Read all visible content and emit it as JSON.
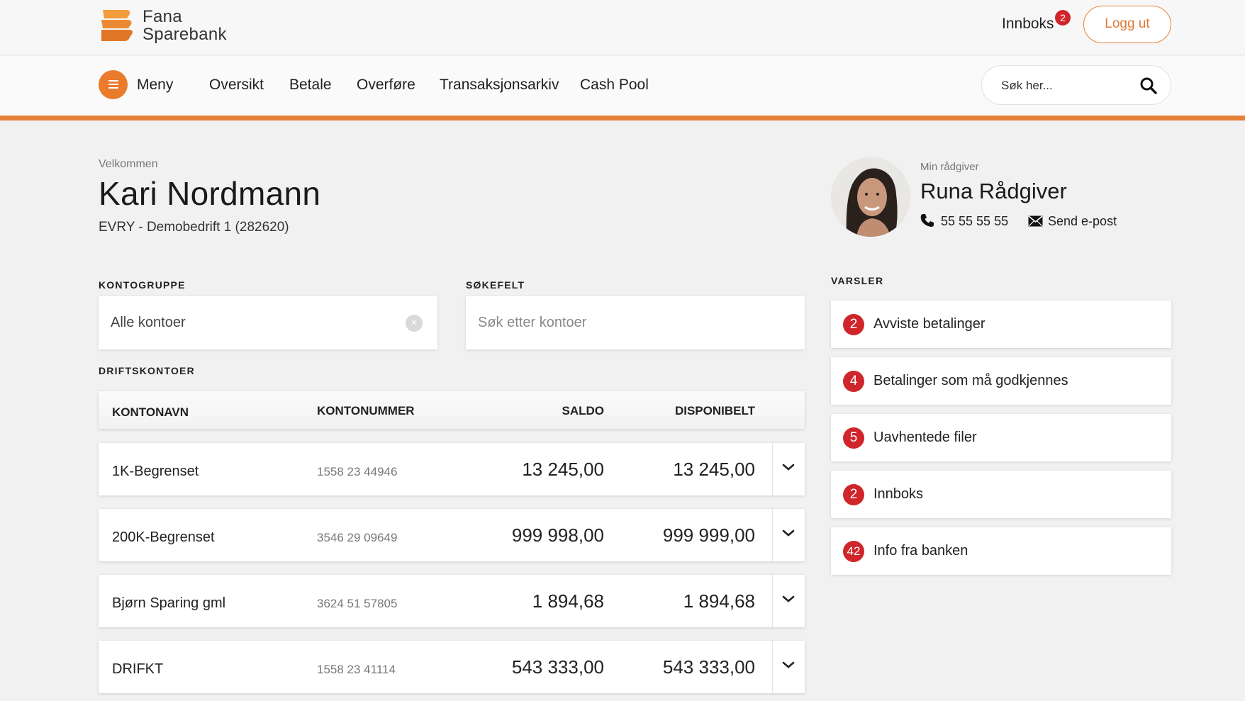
{
  "brand": {
    "line1": "Fana",
    "line2": "Sparebank",
    "accent": "#e8833a"
  },
  "header": {
    "inbox_label": "Innboks",
    "inbox_count": "2",
    "logout_label": "Logg ut"
  },
  "nav": {
    "menu_label": "Meny",
    "items": [
      "Oversikt",
      "Betale",
      "Overføre",
      "Transaksjonsarkiv",
      "Cash Pool"
    ],
    "search_placeholder": "Søk her..."
  },
  "welcome": {
    "greeting": "Velkommen",
    "name": "Kari Nordmann",
    "company": "EVRY - Demobedrift 1 (282620)"
  },
  "advisor": {
    "label": "Min rådgiver",
    "name": "Runa Rådgiver",
    "phone": "55 55 55 55",
    "email_label": "Send e-post"
  },
  "filters": {
    "group_label": "KONTOGRUPPE",
    "group_value": "Alle kontoer",
    "clear_icon": "×",
    "search_label": "SØKEFELT",
    "search_placeholder": "Søk etter kontoer"
  },
  "accounts": {
    "section_label": "DRIFTSKONTOER",
    "columns": {
      "name": "KONTONAVN",
      "number": "KONTONUMMER",
      "balance": "SALDO",
      "available": "DISPONIBELT"
    },
    "rows": [
      {
        "name": "1K-Begrenset",
        "number": "1558 23 44946",
        "balance": "13 245,00",
        "available": "13 245,00"
      },
      {
        "name": "200K-Begrenset",
        "number": "3546 29 09649",
        "balance": "999 998,00",
        "available": "999 999,00"
      },
      {
        "name": "Bjørn Sparing gml",
        "number": "3624 51 57805",
        "balance": "1 894,68",
        "available": "1 894,68"
      },
      {
        "name": "DRIFKT",
        "number": "1558 23 41114",
        "balance": "543 333,00",
        "available": "543 333,00"
      }
    ]
  },
  "alerts": {
    "section_label": "VARSLER",
    "items": [
      {
        "count": "2",
        "label": "Avviste betalinger"
      },
      {
        "count": "4",
        "label": "Betalinger som må godkjennes"
      },
      {
        "count": "5",
        "label": "Uavhentede filer"
      },
      {
        "count": "2",
        "label": "Innboks"
      },
      {
        "count": "42",
        "label": "Info fra banken"
      }
    ]
  }
}
